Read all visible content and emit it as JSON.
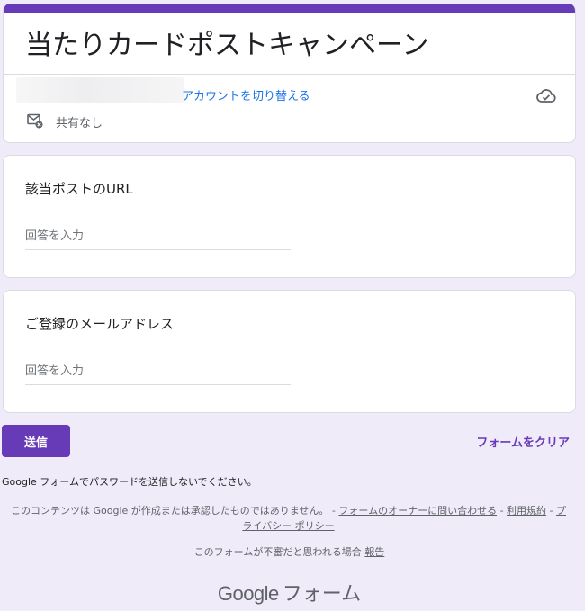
{
  "header": {
    "title": "当たりカードポストキャンペーン",
    "switch_account": "アカウントを切り替える",
    "not_shared": "共有なし",
    "accent_color": "#673ab7",
    "icons": {
      "save_status": "cloud-check-icon",
      "sharing": "mail-blocked-icon"
    }
  },
  "questions": [
    {
      "title": "該当ポストのURL",
      "placeholder": "回答を入力",
      "value": ""
    },
    {
      "title": "ご登録のメールアドレス",
      "placeholder": "回答を入力",
      "value": ""
    }
  ],
  "actions": {
    "submit_label": "送信",
    "clear_label": "フォームをクリア"
  },
  "footer": {
    "password_warning": "Google フォームでパスワードを送信しないでください。",
    "disclaimer_text": "このコンテンツは Google が作成または承認したものではありません。 - ",
    "contact_owner": "フォームのオーナーに問い合わせる",
    "sep1": " - ",
    "terms": "利用規約",
    "sep2": " - ",
    "privacy": "プライバシー ポリシー",
    "suspicious_text": "このフォームが不審だと思われる場合 ",
    "report": "報告",
    "logo_brand": "Google",
    "logo_product": "フォーム"
  },
  "colors": {
    "background": "#f0ebf8",
    "primary": "#673ab7",
    "link_blue": "#1a73e8"
  }
}
